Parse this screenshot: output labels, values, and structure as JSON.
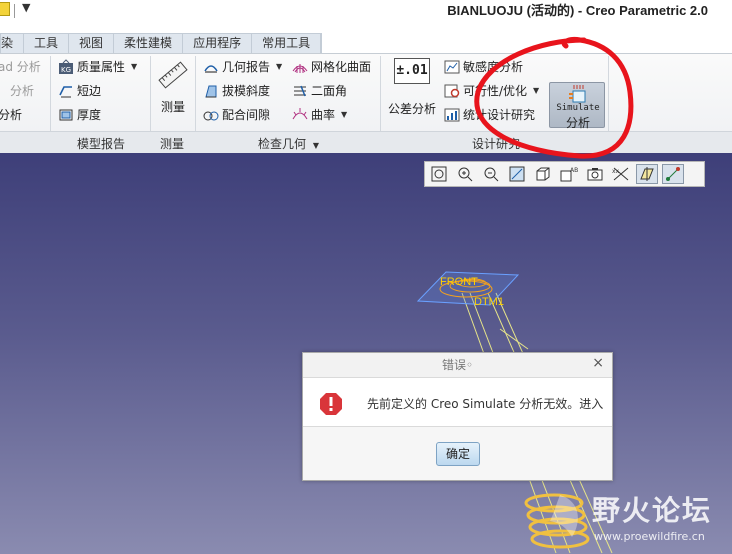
{
  "app": {
    "title": "BIANLUOJU (活动的) - Creo Parametric 2.0",
    "quick_access_dropdown": "▼"
  },
  "tabs": [
    {
      "label": "染"
    },
    {
      "label": "工具"
    },
    {
      "label": "视图"
    },
    {
      "label": "柔性建模"
    },
    {
      "label": "应用程序"
    },
    {
      "label": "常用工具"
    }
  ],
  "ribbon": {
    "partial_group": {
      "items": [
        {
          "label": "ad 分析"
        },
        {
          "label": "分析"
        },
        {
          "label": "分析"
        }
      ]
    },
    "model_report": {
      "label": "模型报告",
      "items": [
        {
          "label": "质量属性",
          "icon": "mass-properties-icon"
        },
        {
          "label": "短边",
          "icon": "short-edge-icon"
        },
        {
          "label": "厚度",
          "icon": "thickness-icon"
        }
      ]
    },
    "measure": {
      "label": "测量",
      "button": "测量"
    },
    "inspect_geometry": {
      "label": "检查几何",
      "items": [
        {
          "label": "几何报告"
        },
        {
          "label": "拔模斜度"
        },
        {
          "label": "配合间隙"
        },
        {
          "label": "网格化曲面"
        },
        {
          "label": "二面角"
        },
        {
          "label": "曲率"
        }
      ]
    },
    "design_study": {
      "label": "设计研究",
      "tolerance_button": "公差分析",
      "tolerance_icon_text": "±.01",
      "items": [
        {
          "label": "敏感度分析"
        },
        {
          "label": "可行性/优化"
        },
        {
          "label": "统计设计研究"
        }
      ]
    },
    "simulate": {
      "label_top": "Simulate",
      "label_bottom": "分析"
    }
  },
  "viewport": {
    "labels": {
      "front": "FRONT",
      "dtm": "DTM1"
    }
  },
  "dialog": {
    "title": "错误◦",
    "close": "×",
    "message": "先前定义的 Creo Simulate 分析无效。进入",
    "ok_label": "确定"
  },
  "watermark": {
    "main": "野火论坛",
    "url": "www.proewildfire.cn"
  },
  "colors": {
    "annotation_circle": "#e8141c",
    "viewport_top": "#3e3f79",
    "dialog_error_icon": "#d9353a"
  }
}
